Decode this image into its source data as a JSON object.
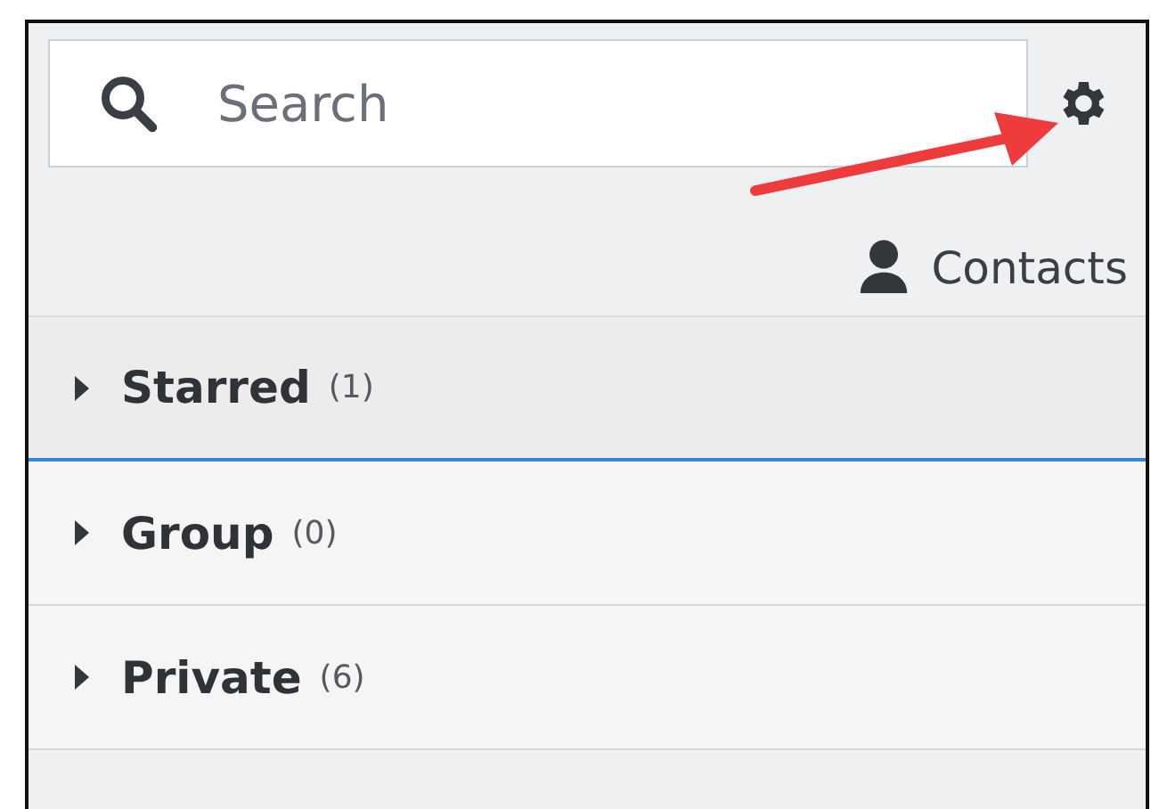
{
  "search": {
    "placeholder": "Search"
  },
  "contacts_link": {
    "label": "Contacts"
  },
  "groups": [
    {
      "name": "Starred",
      "count": "(1)",
      "selected": true,
      "expanded": false
    },
    {
      "name": "Group",
      "count": "(0)",
      "selected": false,
      "expanded": false
    },
    {
      "name": "Private",
      "count": "(6)",
      "selected": false,
      "expanded": false
    }
  ]
}
